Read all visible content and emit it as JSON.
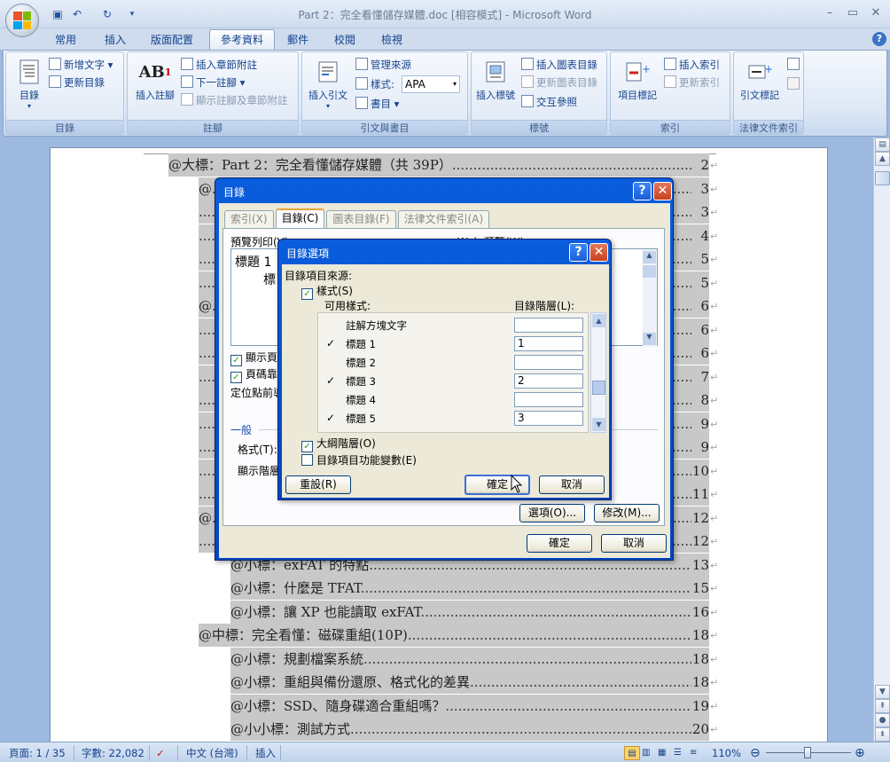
{
  "window": {
    "title": "Part 2：完全看懂儲存媒體.doc [相容模式] - Microsoft Word",
    "minimize": "–",
    "maximize": "▭",
    "close": "✕"
  },
  "tabs": [
    {
      "label": "常用"
    },
    {
      "label": "插入"
    },
    {
      "label": "版面配置"
    },
    {
      "label": "參考資料"
    },
    {
      "label": "郵件"
    },
    {
      "label": "校閱"
    },
    {
      "label": "檢視"
    }
  ],
  "ribbon": {
    "toc_group": {
      "label": "目錄",
      "big": "目錄",
      "add_text": "新增文字",
      "update": "更新目錄"
    },
    "footnote_group": {
      "label": "註腳",
      "big": "插入註腳",
      "insert_endnote": "插入章節附註",
      "next_footnote": "下一註腳",
      "show_notes": "顯示註腳及章節附註"
    },
    "citation_group": {
      "label": "引文與書目",
      "big": "插入引文",
      "manage": "管理來源",
      "style_label": "樣式:",
      "style_value": "APA",
      "bibliography": "書目"
    },
    "caption_group": {
      "label": "標號",
      "big": "插入標號",
      "insert_table_figures": "插入圖表目錄",
      "update_table": "更新圖表目錄",
      "cross_ref": "交互參照"
    },
    "index_group": {
      "label": "索引",
      "big": "項目標記",
      "insert_index": "插入索引",
      "update_index": "更新索引"
    },
    "authorities_group": {
      "label": "法律文件索引",
      "big": "引文標記"
    }
  },
  "document": {
    "toc_lines": [
      {
        "text": "@大標：Part 2：完全看懂儲存媒體（共 39P）",
        "page": "2",
        "indent": 0
      },
      {
        "text": "@",
        "page": "3",
        "indent": 1
      },
      {
        "text": "",
        "page": "3",
        "indent": 1
      },
      {
        "text": "",
        "page": "4",
        "indent": 1
      },
      {
        "text": "",
        "page": "5",
        "indent": 1
      },
      {
        "text": "",
        "page": "5",
        "indent": 1
      },
      {
        "text": "@",
        "page": "6",
        "indent": 1
      },
      {
        "text": "",
        "page": "6",
        "indent": 1
      },
      {
        "text": "",
        "page": "6",
        "indent": 1
      },
      {
        "text": "",
        "page": "7",
        "indent": 1
      },
      {
        "text": "",
        "page": "8",
        "indent": 1
      },
      {
        "text": "",
        "page": "9",
        "indent": 1
      },
      {
        "text": "",
        "page": "9",
        "indent": 1
      },
      {
        "text": "",
        "page": "10",
        "indent": 1
      },
      {
        "text": "",
        "page": "11",
        "indent": 1
      },
      {
        "text": "@",
        "page": "12",
        "indent": 1
      },
      {
        "text": "",
        "page": "12",
        "indent": 1
      },
      {
        "text": "@小標：exFAT 的特點",
        "page": "13",
        "indent": 2
      },
      {
        "text": "@小標：什麼是 TFAT",
        "page": "15",
        "indent": 2
      },
      {
        "text": "@小標：讓 XP 也能讀取 exFAT",
        "page": "16",
        "indent": 2
      },
      {
        "text": "@中標：完全看懂：磁碟重組(10P)",
        "page": "18",
        "indent": 1
      },
      {
        "text": "@小標：規劃檔案系統",
        "page": "18",
        "indent": 2
      },
      {
        "text": "@小標：重組與備份還原、格式化的差異",
        "page": "18",
        "indent": 2
      },
      {
        "text": "@小標：SSD、隨身碟適合重組嗎？",
        "page": "19",
        "indent": 2
      },
      {
        "text": "@小小標：測試方式",
        "page": "20",
        "indent": 2
      }
    ],
    "pilcrow": "↵"
  },
  "toc_dialog": {
    "title": "目錄",
    "help": "?",
    "close": "✕",
    "tabs": [
      {
        "label": "索引(X)"
      },
      {
        "label": "目錄(C)"
      },
      {
        "label": "圖表目錄(F)"
      },
      {
        "label": "法律文件索引(A)"
      }
    ],
    "print_preview_label": "預覽列印(V)",
    "web_preview_label": "Web 預覽(W)",
    "preview_h1": "標題 1",
    "preview_h2": "標",
    "show_page_numbers": "顯示頁",
    "right_align": "頁碼靠",
    "tab_leader": "定位點前導",
    "general_label": "一般",
    "format_label": "格式(T):",
    "show_levels_label": "顯示階層",
    "options_button": "選項(O)...",
    "modify_button": "修改(M)...",
    "ok_button": "確定",
    "cancel_button": "取消"
  },
  "options_dialog": {
    "title": "目錄選項",
    "help": "?",
    "close": "✕",
    "build_from": "目錄項目來源:",
    "styles_check": "樣式(S)",
    "available_styles": "可用樣式:",
    "toc_level": "目錄階層(L):",
    "styles": [
      {
        "name": "註解方塊文字",
        "checked": false,
        "level": ""
      },
      {
        "name": "標題 1",
        "checked": true,
        "level": "1"
      },
      {
        "name": "標題 2",
        "checked": false,
        "level": ""
      },
      {
        "name": "標題 3",
        "checked": true,
        "level": "2"
      },
      {
        "name": "標題 4",
        "checked": false,
        "level": ""
      },
      {
        "name": "標題 5",
        "checked": true,
        "level": "3"
      }
    ],
    "outline_levels": "大綱階層(O)",
    "entry_fields": "目錄項目功能變數(E)",
    "reset_button": "重設(R)",
    "ok_button": "確定",
    "cancel_button": "取消",
    "checkmark": "✓"
  },
  "statusbar": {
    "page": "頁面: 1 / 35",
    "words": "字數: 22,082",
    "language": "中文 (台灣)",
    "mode": "插入",
    "zoom": "110%"
  },
  "colors": {
    "ribbon_text": "#15428b",
    "toc_highlight": "#c8c8c8",
    "dialog_title": "#0a5ddc"
  }
}
